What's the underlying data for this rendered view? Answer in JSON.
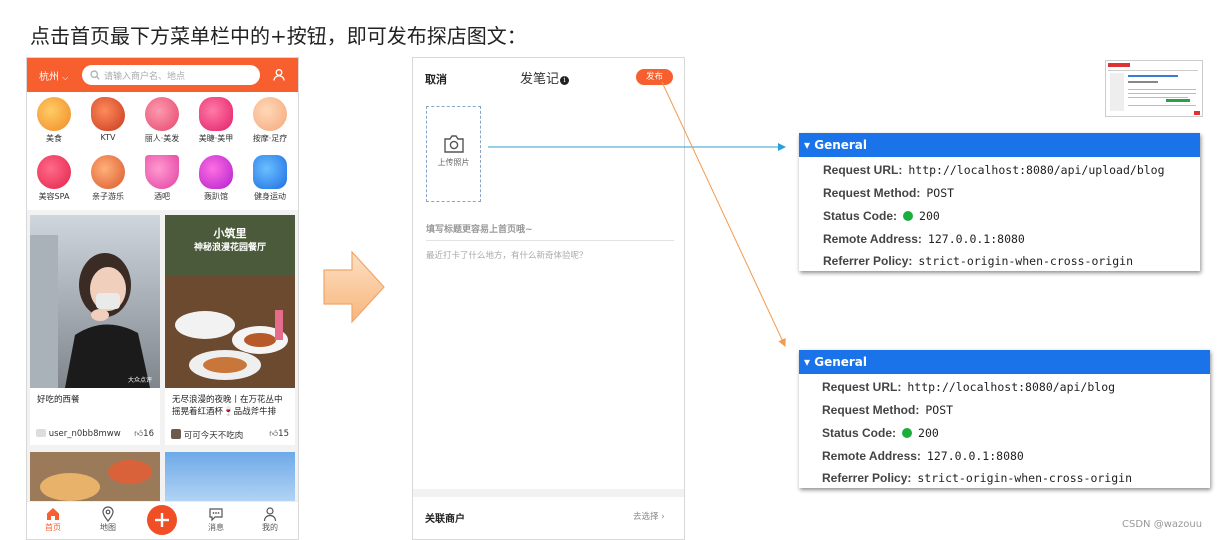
{
  "page_title": "点击首页最下方菜单栏中的+按钮，即可发布探店图文：",
  "home": {
    "city": "杭州",
    "search_placeholder": "请输入商户名、地点",
    "categories": [
      "美食",
      "KTV",
      "丽人·美发",
      "美睫·美甲",
      "按摩·足疗",
      "美容SPA",
      "亲子游乐",
      "酒吧",
      "轰趴馆",
      "健身运动"
    ],
    "cards": [
      {
        "title": "好吃的西餐",
        "user": "user_n0bb8mww",
        "likes": "16"
      },
      {
        "title": "无尽浪漫的夜晚丨在万花丛中摇晃着红酒杯🍷品战斧牛排",
        "overlay1": "小筑里",
        "overlay2": "神秘浪漫花园餐厅",
        "user": "可可今天不吃肉",
        "likes": "15"
      }
    ],
    "photo_watermark": "大众点评",
    "tabs": [
      "首页",
      "地图",
      "消息",
      "我的"
    ]
  },
  "editor": {
    "cancel": "取消",
    "title": "发笔记",
    "publish": "发布",
    "upload_label": "上传照片",
    "title_placeholder": "填写标题更容易上首页哦~",
    "content_placeholder": "最近打卡了什么地方，有什么新奇体验呢？",
    "linked_shop": "关联商户",
    "choose": "去选择"
  },
  "requests": [
    {
      "header": "General",
      "url_label": "Request URL:",
      "url": "http://localhost:8080/api/upload/blog",
      "method_label": "Request Method:",
      "method": "POST",
      "status_label": "Status Code:",
      "status": "200",
      "remote_label": "Remote Address:",
      "remote": "127.0.0.1:8080",
      "referrer_label": "Referrer Policy:",
      "referrer": "strict-origin-when-cross-origin"
    },
    {
      "header": "General",
      "url_label": "Request URL:",
      "url": "http://localhost:8080/api/blog",
      "method_label": "Request Method:",
      "method": "POST",
      "status_label": "Status Code:",
      "status": "200",
      "remote_label": "Remote Address:",
      "remote": "127.0.0.1:8080",
      "referrer_label": "Referrer Policy:",
      "referrer": "strict-origin-when-cross-origin"
    }
  ],
  "colors": {
    "brand": "#f85f2e",
    "devtools_blue": "#1a73e8",
    "status_green": "#1aae3c",
    "arrow_blue": "#2a9fd8",
    "arrow_orange": "#f39a4c"
  },
  "watermark": "CSDN @wazouu"
}
